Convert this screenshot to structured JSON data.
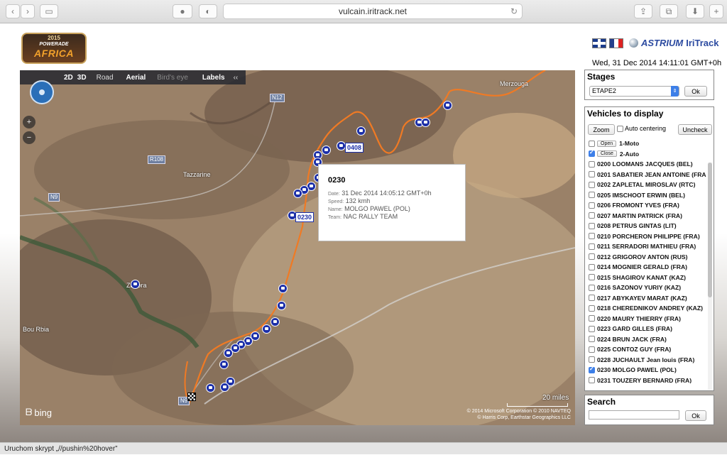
{
  "browser": {
    "url": "vulcain.iritrack.net",
    "status_text": "Uruchom skrypt „//pushin%20hover”"
  },
  "header": {
    "logo": {
      "year": "2015",
      "sponsor": "POWERADE",
      "name": "AFRICA"
    },
    "brand_astrium": "ASTRIUM",
    "brand_iritrack": "IriTrack",
    "datetime": "Wed, 31 Dec 2014 14:11:01 GMT+0h"
  },
  "map": {
    "toolbar": {
      "mode_2d": "2D",
      "mode_3d": "3D",
      "road": "Road",
      "aerial": "Aerial",
      "birds_eye": "Bird's eye",
      "labels": "Labels",
      "collapse": "‹‹"
    },
    "places": {
      "tazzarine": "Tazzarine",
      "merzouga": "Merzouga",
      "zagora": "Zagora",
      "bou_rbia": "Bou Rbia"
    },
    "roads": {
      "n12": "N12",
      "r108": "R108",
      "n9": "N9",
      "n9b": "N9"
    },
    "vehicle_labels": {
      "v0408": "0408",
      "v0230": "0230"
    },
    "scale": "20 miles",
    "bing": "bing",
    "copyright_1": "© 2014 Microsoft Corporation   © 2010 NAVTEQ",
    "copyright_2": "© Harris Corp, Earthstar Geographics LLC",
    "popup": {
      "id": "0230",
      "date_label": "Date:",
      "date": "31 Dec 2014 14:05:12 GMT+0h",
      "speed_label": "Speed:",
      "speed": "132 kmh",
      "name_label": "Name:",
      "name": "MOLGO PAWEL (POL)",
      "team_label": "Team:",
      "team": "NAC RALLY TEAM"
    }
  },
  "stages": {
    "title": "Stages",
    "selected": "ETAPE2",
    "ok": "Ok"
  },
  "vehicles": {
    "title": "Vehicles to display",
    "zoom": "Zoom",
    "auto_centering": "Auto centering",
    "uncheck": "Uncheck",
    "groups": [
      {
        "button": "Open",
        "label": "1-Moto",
        "checked": false
      },
      {
        "button": "Close",
        "label": "2-Auto",
        "checked": true
      }
    ],
    "items": [
      {
        "label": "0200 LOOMANS JACQUES (BEL)",
        "checked": false
      },
      {
        "label": "0201 SABATIER JEAN ANTOINE (FRA",
        "checked": false
      },
      {
        "label": "0202 ZAPLETAL MIROSLAV (RTC)",
        "checked": false
      },
      {
        "label": "0205 IMSCHOOT ERWIN (BEL)",
        "checked": false
      },
      {
        "label": "0206 FROMONT YVES (FRA)",
        "checked": false
      },
      {
        "label": "0207 MARTIN PATRICK (FRA)",
        "checked": false
      },
      {
        "label": "0208 PETRUS GINTAS (LIT)",
        "checked": false
      },
      {
        "label": "0210 PORCHERON PHILIPPE (FRA)",
        "checked": false
      },
      {
        "label": "0211 SERRADORI MATHIEU (FRA)",
        "checked": false
      },
      {
        "label": "0212 GRIGOROV ANTON (RUS)",
        "checked": false
      },
      {
        "label": "0214 MOGNIER GERALD (FRA)",
        "checked": false
      },
      {
        "label": "0215 SHAGIROV KANAT (KAZ)",
        "checked": false
      },
      {
        "label": "0216 SAZONOV YURIY (KAZ)",
        "checked": false
      },
      {
        "label": "0217 ABYKAYEV MARAT (KAZ)",
        "checked": false
      },
      {
        "label": "0218 CHEREDNIKOV ANDREY (KAZ)",
        "checked": false
      },
      {
        "label": "0220 MAURY THIERRY (FRA)",
        "checked": false
      },
      {
        "label": "0223 GARD GILLES (FRA)",
        "checked": false
      },
      {
        "label": "0224 BRUN JACK (FRA)",
        "checked": false
      },
      {
        "label": "0225 CONTOZ GUY (FRA)",
        "checked": false
      },
      {
        "label": "0228 JUCHAULT Jean louis (FRA)",
        "checked": false
      },
      {
        "label": "0230 MOLGO PAWEL (POL)",
        "checked": true
      },
      {
        "label": "0231 TOUZERY BERNARD (FRA)",
        "checked": false
      }
    ]
  },
  "search": {
    "title": "Search",
    "ok": "Ok",
    "value": ""
  }
}
